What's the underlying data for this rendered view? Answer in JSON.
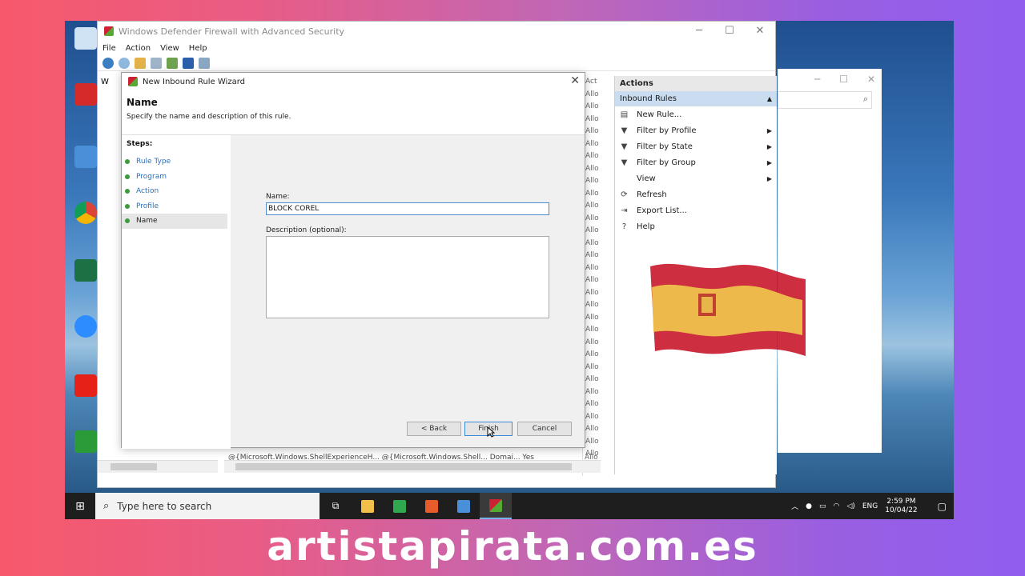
{
  "firewall_window": {
    "title": "Windows Defender Firewall with Advanced Security",
    "menu": [
      "File",
      "Action",
      "View",
      "Help"
    ],
    "controls": [
      "─",
      "☐",
      "✕"
    ],
    "left_tree_label": "W",
    "column_rows": [
      "Act",
      "Allo",
      "Allo",
      "Allo",
      "Allo",
      "Allo",
      "Allo",
      "Allo",
      "Allo",
      "Allo",
      "Allo",
      "Allo",
      "Allo",
      "Allo",
      "Allo",
      "Allo",
      "Allo",
      "Allo",
      "Allo",
      "Allo",
      "Allo",
      "Allo",
      "Allo",
      "Allo",
      "Allo",
      "Allo",
      "Allo",
      "Allo",
      "Allo",
      "Allo",
      "Allo"
    ],
    "bottom_row": "@{Microsoft.Windows.ShellExperienceH...   @{Microsoft.Windows.Shell...   Domai...   Yes",
    "bottom_row_tail": "Allo"
  },
  "actions_pane": {
    "header": "Actions",
    "group": "Inbound Rules",
    "items": [
      {
        "label": "New Rule...",
        "icon": "new-rule-icon",
        "glyph": "▤",
        "submenu": false
      },
      {
        "label": "Filter by Profile",
        "icon": "filter-icon",
        "glyph": "▼",
        "submenu": true
      },
      {
        "label": "Filter by State",
        "icon": "filter-icon",
        "glyph": "▼",
        "submenu": true
      },
      {
        "label": "Filter by Group",
        "icon": "filter-icon",
        "glyph": "▼",
        "submenu": true
      },
      {
        "label": "View",
        "icon": "view-icon",
        "glyph": "",
        "submenu": true
      },
      {
        "label": "Refresh",
        "icon": "refresh-icon",
        "glyph": "⟳",
        "submenu": false
      },
      {
        "label": "Export List...",
        "icon": "export-icon",
        "glyph": "⇥",
        "submenu": false
      },
      {
        "label": "Help",
        "icon": "help-icon",
        "glyph": "?",
        "submenu": false
      }
    ]
  },
  "wizard": {
    "title": "New Inbound Rule Wizard",
    "heading": "Name",
    "subheading": "Specify the name and description of this rule.",
    "steps_header": "Steps:",
    "steps": [
      "Rule Type",
      "Program",
      "Action",
      "Profile",
      "Name"
    ],
    "active_step": 4,
    "name_label": "Name:",
    "name_value": "BLOCK COREL",
    "description_label": "Description (optional):",
    "description_value": "",
    "buttons": {
      "back": "< Back",
      "finish": "Finish",
      "cancel": "Cancel"
    }
  },
  "taskbar": {
    "search_placeholder": "Type here to search",
    "language": "ENG",
    "time": "2:59 PM",
    "date": "10/04/22"
  },
  "watermark": "artistapirata.com.es",
  "colors": {
    "accent": "#2d6fb8",
    "actions_group_bg": "#c9dcf0",
    "flag_red": "#c60b1e",
    "flag_yellow": "#f2c94c"
  }
}
